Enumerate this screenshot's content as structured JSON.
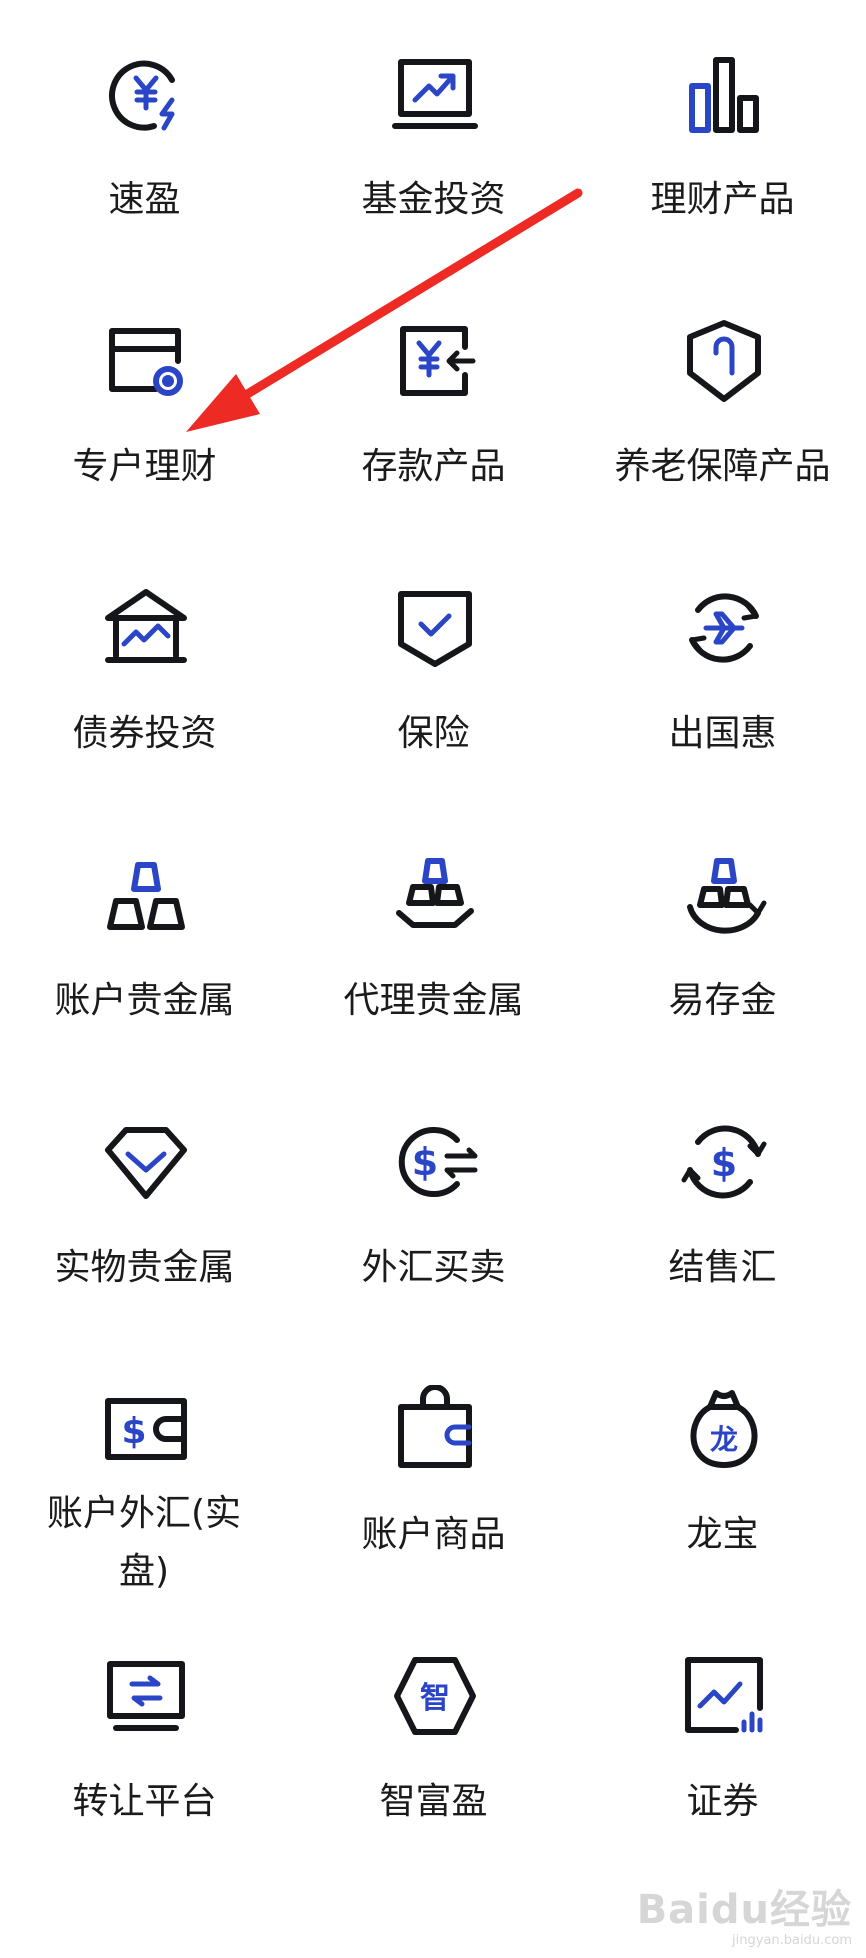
{
  "colors": {
    "ink": "#15161a",
    "accent": "#2b45c7",
    "arrow": "#ee2a24"
  },
  "items": [
    {
      "label": "速盈",
      "icon": "yuan-lightning-icon"
    },
    {
      "label": "基金投资",
      "icon": "monitor-chart-icon"
    },
    {
      "label": "理财产品",
      "icon": "bar-chart-icon"
    },
    {
      "label": "专户理财",
      "icon": "card-coin-icon"
    },
    {
      "label": "存款产品",
      "icon": "yuan-deposit-icon"
    },
    {
      "label": "养老保障产品",
      "icon": "shield-cane-icon"
    },
    {
      "label": "债券投资",
      "icon": "bank-chart-icon"
    },
    {
      "label": "保险",
      "icon": "shield-check-icon"
    },
    {
      "label": "出国惠",
      "icon": "airplane-cycle-icon"
    },
    {
      "label": "账户贵金属",
      "icon": "gold-bars-icon"
    },
    {
      "label": "代理贵金属",
      "icon": "gold-hand-icon"
    },
    {
      "label": "易存金",
      "icon": "gold-cycle-icon"
    },
    {
      "label": "实物贵金属",
      "icon": "diamond-icon"
    },
    {
      "label": "外汇买卖",
      "icon": "dollar-exchange-icon"
    },
    {
      "label": "结售汇",
      "icon": "dollar-cycle-icon"
    },
    {
      "label": "账户外汇(实盘)",
      "icon": "dollar-wallet-icon"
    },
    {
      "label": "账户商品",
      "icon": "shopping-bag-icon"
    },
    {
      "label": "龙宝",
      "icon": "money-bag-icon"
    },
    {
      "label": "转让平台",
      "icon": "monitor-transfer-icon"
    },
    {
      "label": "智富盈",
      "icon": "hexagon-zhi-icon"
    },
    {
      "label": "证券",
      "icon": "stock-chart-icon"
    }
  ],
  "watermark": {
    "logo": "Baidu经验",
    "url": "jingyan.baidu.com"
  }
}
